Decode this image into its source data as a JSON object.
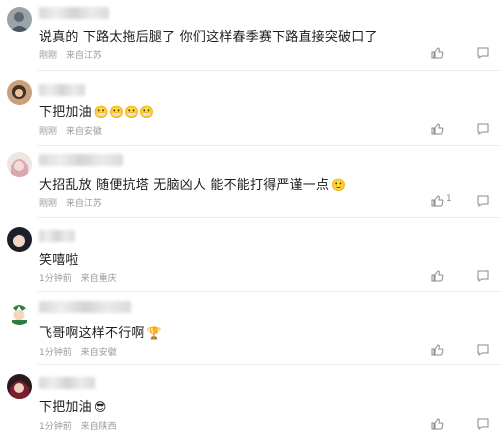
{
  "comments": [
    {
      "text": "说真的 下路太拖后腿了 你们这样春季赛下路直接突破口了",
      "time": "刚刚",
      "location": "来自江苏",
      "likes": "",
      "emojis": ""
    },
    {
      "text": "下把加油",
      "time": "刚刚",
      "location": "来自安徽",
      "likes": "",
      "emojis": "😬😬😬😬"
    },
    {
      "text": "大招乱放 随便抗塔 无脑凶人 能不能打得严谨一点",
      "time": "刚刚",
      "location": "来自江苏",
      "likes": "1",
      "emojis": "🙂"
    },
    {
      "text": "笑嘻啦",
      "time": "1分钟前",
      "location": "来自重庆",
      "likes": "",
      "emojis": ""
    },
    {
      "text": "飞哥啊这样不行啊",
      "time": "1分钟前",
      "location": "来自安徽",
      "likes": "",
      "emojis": "🏆"
    },
    {
      "text": "下把加油",
      "time": "1分钟前",
      "location": "来自陕西",
      "likes": "",
      "emojis": "😎"
    }
  ],
  "icons": {
    "like": "thumbs-up-icon",
    "reply": "comment-bubble-icon"
  },
  "colors": {
    "meta": "#9a9a9a",
    "text": "#1c1c1c",
    "divider": "#ececec",
    "icon": "#8a8a8a"
  }
}
